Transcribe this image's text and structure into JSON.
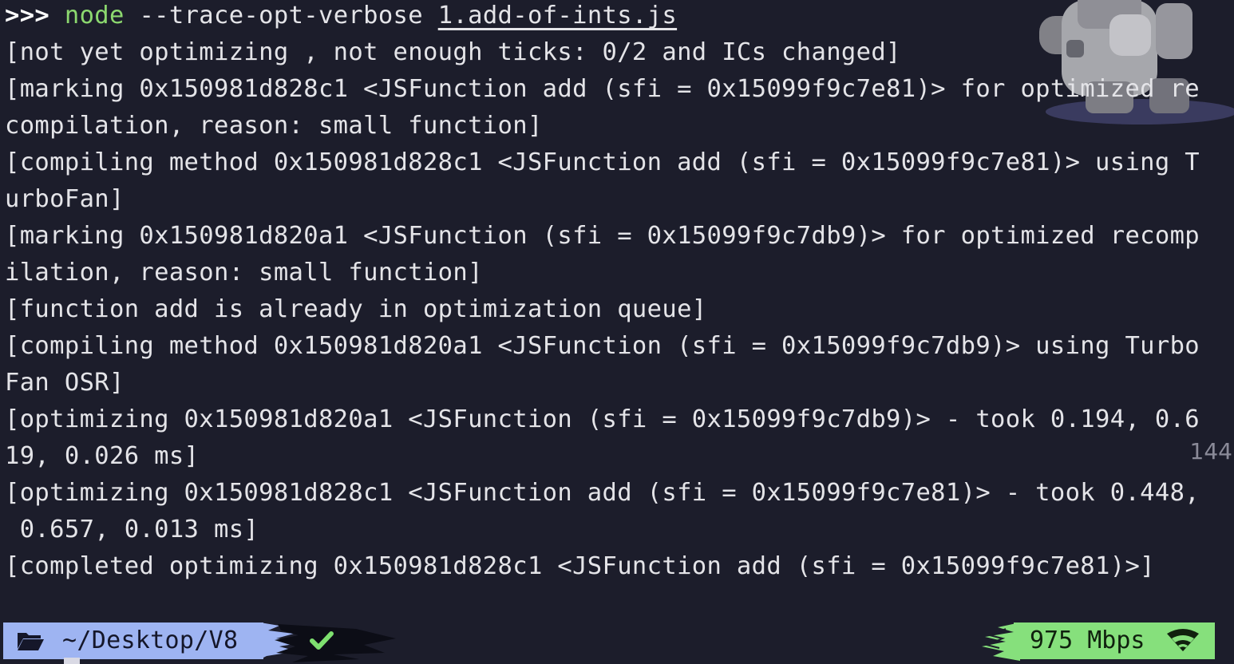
{
  "terminal": {
    "prompt": ">>>",
    "command": {
      "program": "node",
      "flag": "--trace-opt-verbose",
      "file": "1.add-of-ints.js"
    },
    "output_lines": [
      "[not yet optimizing , not enough ticks: 0/2 and ICs changed]",
      "[marking 0x150981d828c1 <JSFunction add (sfi = 0x15099f9c7e81)> for optimized re",
      "compilation, reason: small function]",
      "[compiling method 0x150981d828c1 <JSFunction add (sfi = 0x15099f9c7e81)> using T",
      "urboFan]",
      "[marking 0x150981d820a1 <JSFunction (sfi = 0x15099f9c7db9)> for optimized recomp",
      "ilation, reason: small function]",
      "[function add is already in optimization queue]",
      "[compiling method 0x150981d820a1 <JSFunction (sfi = 0x15099f9c7db9)> using Turbo",
      "Fan OSR]",
      "[optimizing 0x150981d820a1 <JSFunction (sfi = 0x15099f9c7db9)> - took 0.194, 0.6",
      "19, 0.026 ms]",
      "[optimizing 0x150981d828c1 <JSFunction add (sfi = 0x15099f9c7e81)> - took 0.448,",
      " 0.657, 0.013 ms]",
      "[completed optimizing 0x150981d828c1 <JSFunction add (sfi = 0x15099f9c7e81)>]"
    ],
    "line_number_badge": "144"
  },
  "status_bar": {
    "path": "~/Desktop/V8",
    "network_speed": "975 Mbps",
    "icons": {
      "folder": "folder-open-icon",
      "git_status": "check-icon",
      "wifi": "wifi-icon"
    }
  },
  "colors": {
    "background": "#1c1d2b",
    "text": "#e4e4e8",
    "command": "#8cd86f",
    "path_segment": "#9eb4f2",
    "network_segment": "#86e07c",
    "check": "#7ee06f"
  }
}
